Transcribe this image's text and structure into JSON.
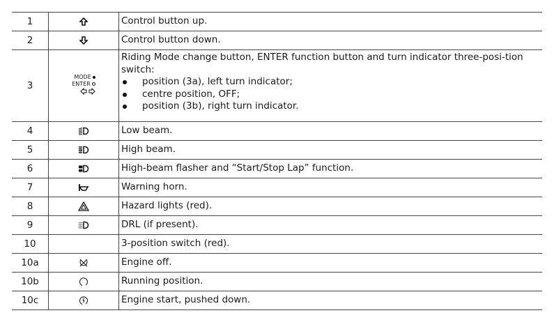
{
  "rows": [
    {
      "num": "1",
      "icon": "arrow-up-icon",
      "desc": "Control button up."
    },
    {
      "num": "2",
      "icon": "arrow-down-icon",
      "desc": "Control button down."
    },
    {
      "num": "3",
      "icon": "mode-enter-turn-switch-icon",
      "icon_text": [
        "MODE",
        "ENTER"
      ],
      "desc": "Riding Mode change button, ENTER function button and turn indicator three-posi-tion switch:",
      "bullets": [
        "position (3a), left turn indicator;",
        "centre position, OFF;",
        "position (3b), right turn indicator."
      ]
    },
    {
      "num": "4",
      "icon": "low-beam-icon",
      "desc": "Low beam."
    },
    {
      "num": "5",
      "icon": "high-beam-icon",
      "desc": "High beam."
    },
    {
      "num": "6",
      "icon": "high-beam-flasher-icon",
      "desc": "High-beam flasher and “Start/Stop Lap” function."
    },
    {
      "num": "7",
      "icon": "horn-icon",
      "desc": "Warning horn."
    },
    {
      "num": "8",
      "icon": "hazard-icon",
      "desc": "Hazard lights (red)."
    },
    {
      "num": "9",
      "icon": "drl-icon",
      "desc": "DRL (if present)."
    },
    {
      "num": "10",
      "icon": "",
      "desc": "3-position switch (red)."
    },
    {
      "num": "10a",
      "icon": "engine-off-icon",
      "desc": "Engine off."
    },
    {
      "num": "10b",
      "icon": "running-position-icon",
      "desc": "Running position."
    },
    {
      "num": "10c",
      "icon": "engine-start-icon",
      "desc": "Engine start, pushed down."
    }
  ]
}
